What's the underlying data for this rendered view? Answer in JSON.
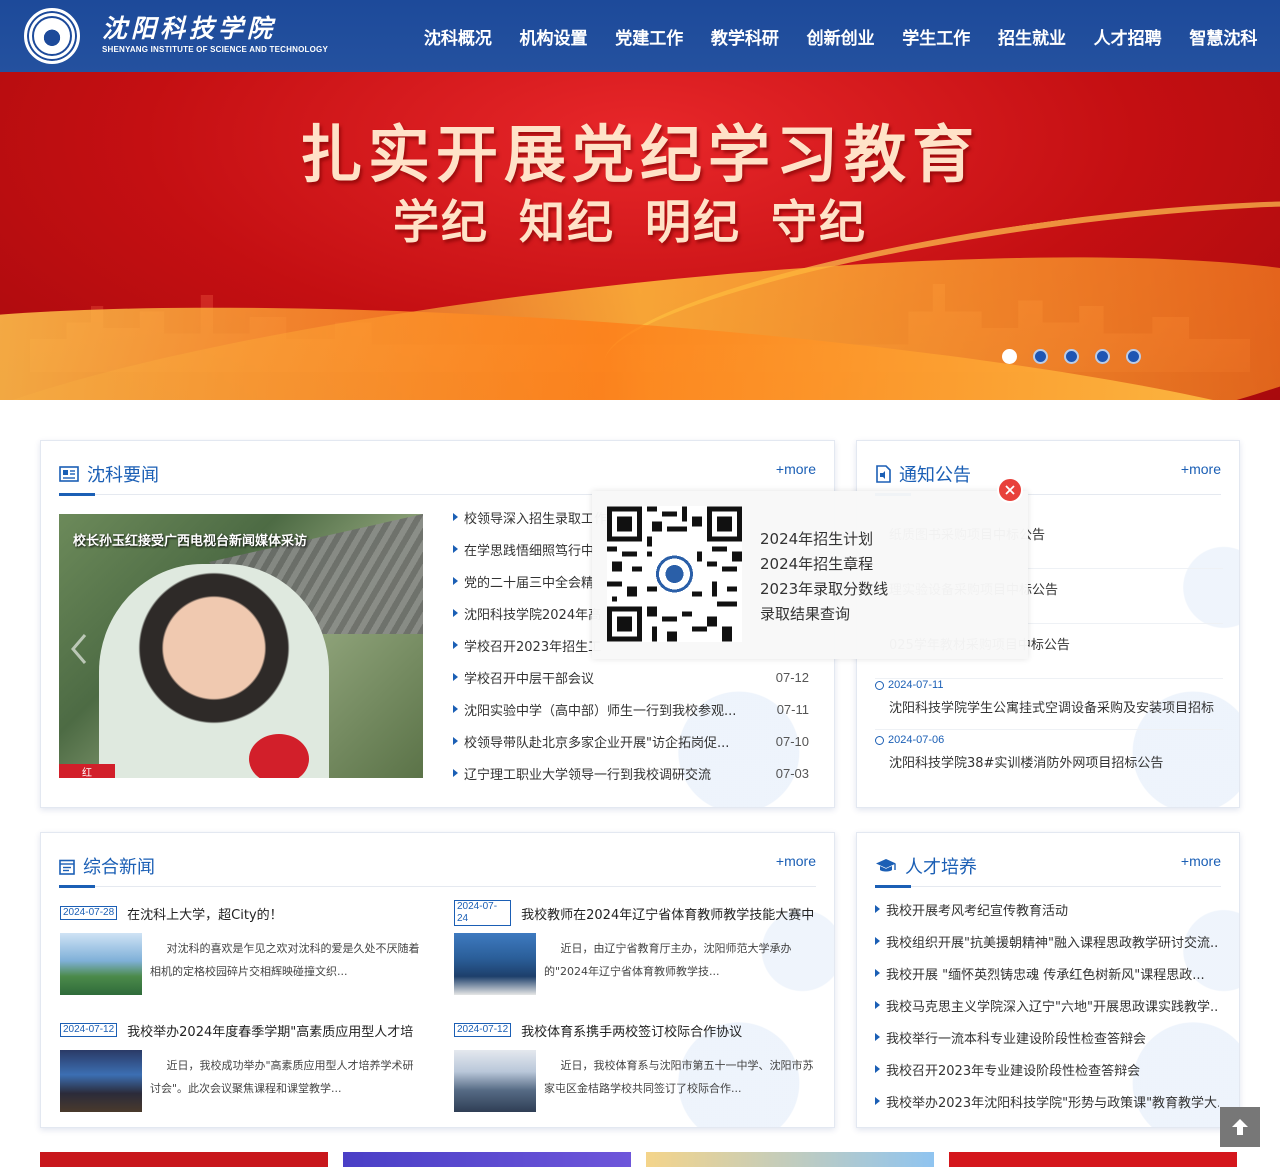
{
  "header": {
    "logo_cn": "沈阳科技学院",
    "logo_en": "SHENYANG INSTITUTE OF SCIENCE AND TECHNOLOGY",
    "nav": [
      "沈科概况",
      "机构设置",
      "党建工作",
      "教学科研",
      "创新创业",
      "学生工作",
      "招生就业",
      "人才招聘",
      "智慧沈科"
    ]
  },
  "banner": {
    "title": "扎实开展党纪学习教育",
    "sub": [
      "学纪",
      "知纪",
      "明纪",
      "守纪"
    ],
    "slides": 5,
    "active_slide": 1
  },
  "news": {
    "title": "沈科要闻",
    "more": "+more",
    "photo_caption": "校长孙玉红接受广西电视台新闻媒体采访",
    "photo_badge": "红",
    "items": [
      {
        "text": "校领导深入招生录取工作",
        "date": ""
      },
      {
        "text": "在学思践悟细照笃行中",
        "date": ""
      },
      {
        "text": "党的二十届三中全会精",
        "date": ""
      },
      {
        "text": "沈阳科技学院2024年高",
        "date": ""
      },
      {
        "text": "学校召开2023年招生工",
        "date": ""
      },
      {
        "text": "学校召开中层干部会议",
        "date": "07-12"
      },
      {
        "text": "沈阳实验中学（高中部）师生一行到我校参观...",
        "date": "07-11"
      },
      {
        "text": "校领导带队赴北京多家企业开展\"访企拓岗促...",
        "date": "07-10"
      },
      {
        "text": "辽宁理工职业大学领导一行到我校调研交流",
        "date": "07-03"
      }
    ]
  },
  "notice": {
    "title": "通知公告",
    "more": "+more",
    "items": [
      {
        "date": "",
        "text": "纸质图书采购项目中标公告"
      },
      {
        "date": "",
        "text": "理实验设备采购项目中标公告"
      },
      {
        "date": "",
        "text": "025学年教材采购项目中标公告"
      },
      {
        "date": "2024-07-11",
        "text": "沈阳科技学院学生公寓挂式空调设备采购及安装项目招标"
      },
      {
        "date": "2024-07-06",
        "text": "沈阳科技学院38#实训楼消防外网项目招标公告"
      }
    ]
  },
  "composite": {
    "title": "综合新闻",
    "more": "+more",
    "items": [
      {
        "date": "2024-07-28",
        "title": "在沈科上大学，超City的！",
        "summary": "对沈科的喜欢是乍见之欢对沈科的爱是久处不厌随着相机的定格校园碎片交相辉映碰撞文织..."
      },
      {
        "date": "2024-07-24",
        "title": "我校教师在2024年辽宁省体育教师教学技能大赛中",
        "summary": "近日，由辽宁省教育厅主办，沈阳师范大学承办的\"2024年辽宁省体育教师教学技..."
      },
      {
        "date": "2024-07-12",
        "title": "我校举办2024年度春季学期\"高素质应用型人才培",
        "summary": "近日，我校成功举办\"高素质应用型人才培养学术研讨会\"。此次会议聚焦课程和课堂教学..."
      },
      {
        "date": "2024-07-12",
        "title": "我校体育系携手两校签订校际合作协议",
        "summary": "近日，我校体育系与沈阳市第五十一中学、沈阳市苏家屯区金桔路学校共同签订了校际合作..."
      }
    ]
  },
  "talent": {
    "title": "人才培养",
    "more": "+more",
    "items": [
      "我校开展考风考纪宣传教育活动",
      "我校组织开展\"抗美援朝精神\"融入课程思政教学研讨交流...",
      "我校开展 \"缅怀英烈铸忠魂 传承红色树新风\"课程思政...",
      "我校马克思主义学院深入辽宁\"六地\"开展思政课实践教学...",
      "我校举行一流本科专业建设阶段性检查答辩会",
      "我校召开2023年专业建设阶段性检查答辩会",
      "我校举办2023年沈阳科技学院\"形势与政策课\"教育教学大..."
    ]
  },
  "popup": {
    "links": [
      "2024年招生计划",
      "2024年招生章程",
      "2023年录取分数线",
      "录取结果查询"
    ]
  },
  "colors": {
    "header": "#1d4a9a",
    "accent": "#1b5fb5",
    "banner_red": "#c40f12",
    "close": "#e8413b",
    "strip": [
      "#c8171c",
      "#5b4bd0",
      "#8fc4f0",
      "#d4161c"
    ]
  }
}
